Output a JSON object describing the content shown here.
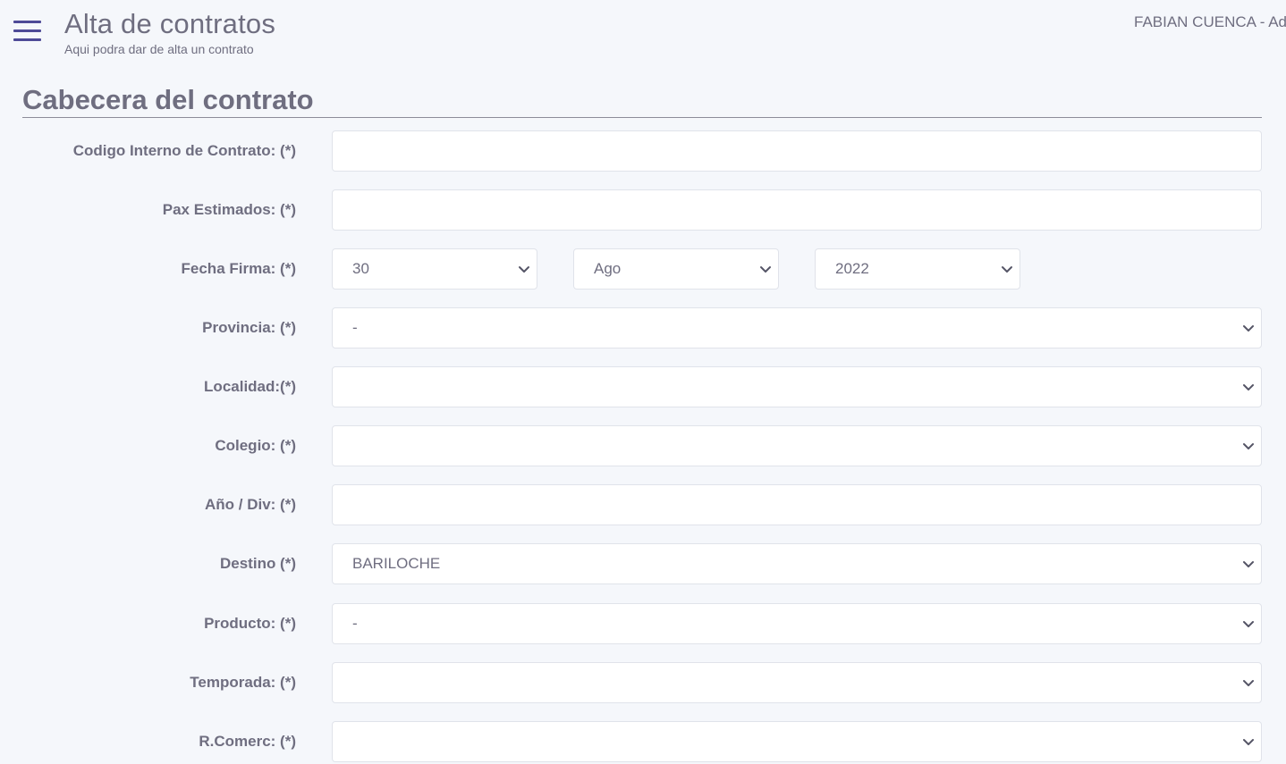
{
  "header": {
    "title": "Alta de contratos",
    "subtitle": "Aqui podra dar de alta un contrato",
    "user": "FABIAN CUENCA - Adr"
  },
  "section": {
    "title": "Cabecera del contrato"
  },
  "form": {
    "codigo_interno": {
      "label": "Codigo Interno de Contrato: (*)",
      "value": "",
      "placeholder": ""
    },
    "pax_estimados": {
      "label": "Pax Estimados: (*)",
      "value": "",
      "placeholder": ""
    },
    "fecha_firma": {
      "label": "Fecha Firma: (*)",
      "day": "30",
      "month": "Ago",
      "year": "2022"
    },
    "provincia": {
      "label": "Provincia: (*)",
      "value": "-"
    },
    "localidad": {
      "label": "Localidad:(*)",
      "value": ""
    },
    "colegio": {
      "label": "Colegio: (*)",
      "value": ""
    },
    "anio_div": {
      "label": "Año / Div: (*)",
      "value": "",
      "placeholder": ""
    },
    "destino": {
      "label": "Destino (*)",
      "value": "BARILOCHE"
    },
    "producto": {
      "label": "Producto: (*)",
      "value": "-"
    },
    "temporada": {
      "label": "Temporada: (*)",
      "value": ""
    },
    "rcomerc": {
      "label": "R.Comerc: (*)",
      "value": ""
    }
  },
  "icons": {
    "menu": "hamburger-menu-icon",
    "dropdown": "chevron-down-icon"
  },
  "colors": {
    "background": "#f5f7fb",
    "accent": "#4e4a97",
    "text": "#6f6e80",
    "input_border": "#e0e3ea"
  }
}
